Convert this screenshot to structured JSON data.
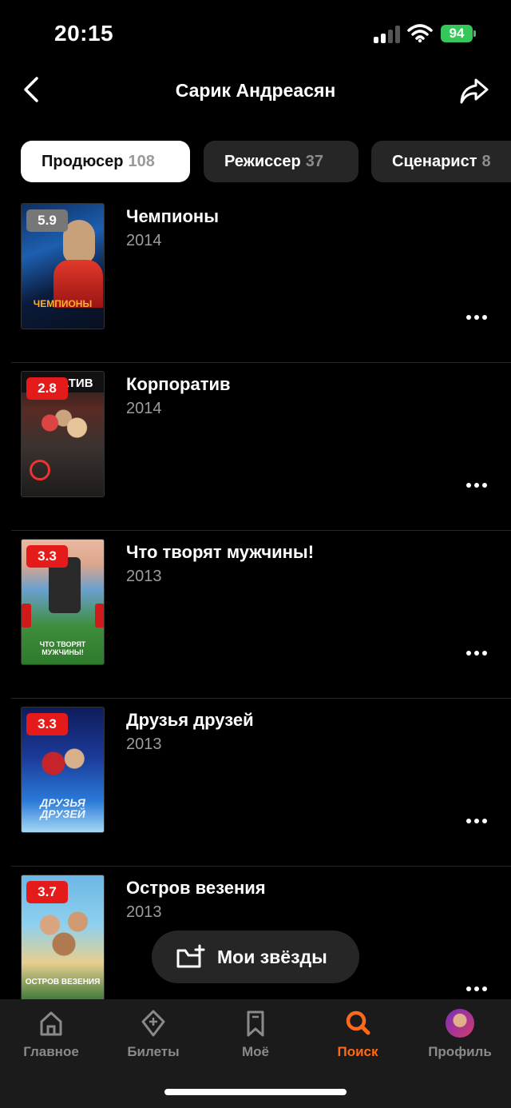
{
  "status": {
    "time": "20:15",
    "battery": "94"
  },
  "header": {
    "title": "Сарик Андреасян"
  },
  "tabs": [
    {
      "label": "Продюсер",
      "count": "108"
    },
    {
      "label": "Режиссер",
      "count": "37"
    },
    {
      "label": "Сценарист",
      "count": "8"
    }
  ],
  "films": [
    {
      "title": "Чемпионы",
      "year": "2014",
      "rating": "5.9",
      "poster_caption": "ЧЕМПИОНЫ"
    },
    {
      "title": "Корпоратив",
      "year": "2014",
      "rating": "2.8",
      "poster_caption": "РАТИВ"
    },
    {
      "title": "Что творят мужчины!",
      "year": "2013",
      "rating": "3.3",
      "poster_caption": "ЧТО ТВОРЯТ МУЖЧИНЫ!"
    },
    {
      "title": "Друзья друзей",
      "year": "2013",
      "rating": "3.3",
      "poster_caption": "ДРУЗЬЯ ДРУЗЕЙ"
    },
    {
      "title": "Остров везения",
      "year": "2013",
      "rating": "3.7",
      "poster_caption": "ОСТРОВ ВЕЗЕНИЯ"
    }
  ],
  "floating_button": {
    "label": "Мои звёзды"
  },
  "tab_bar": [
    {
      "label": "Главное",
      "icon": "home-icon"
    },
    {
      "label": "Билеты",
      "icon": "ticket-icon"
    },
    {
      "label": "Моё",
      "icon": "bookmark-icon"
    },
    {
      "label": "Поиск",
      "icon": "search-icon"
    },
    {
      "label": "Профиль",
      "icon": "avatar"
    }
  ],
  "colors": {
    "accent": "#ff6a1a",
    "rating_low": "#e51a1a",
    "rating_neutral": "#777777",
    "battery": "#35c759"
  }
}
